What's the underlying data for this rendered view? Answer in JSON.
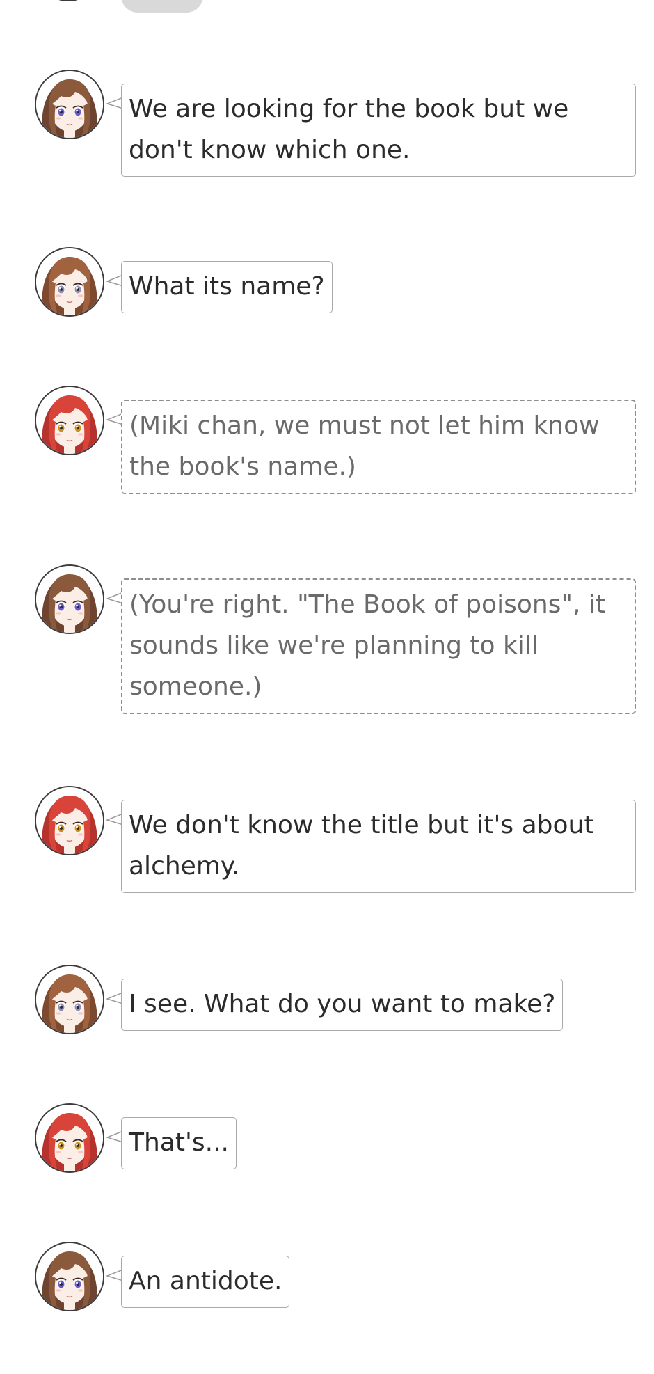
{
  "characters": {
    "brown": {
      "hair": "#8b5a3c",
      "hair_dark": "#6e4430",
      "eye": "#6a5acd",
      "skin": "#fbeee6"
    },
    "auburn": {
      "hair": "#a0623f",
      "hair_dark": "#7d4a2f",
      "eye": "#8f8fb8",
      "skin": "#fbeee6"
    },
    "red": {
      "hair": "#d9443a",
      "hair_dark": "#b5332c",
      "eye": "#c9901c",
      "skin": "#fbeee6"
    }
  },
  "messages": [
    {
      "speaker": "brown",
      "kind": "speech",
      "text": "We are looking for the book but we don't know which one."
    },
    {
      "speaker": "auburn",
      "kind": "speech",
      "text": "What its name?"
    },
    {
      "speaker": "red",
      "kind": "thought",
      "text": "(Miki chan, we must not let him know the book's name.)"
    },
    {
      "speaker": "brown",
      "kind": "thought",
      "text": "(You're right. \"The Book of poisons\", it sounds like we're planning to kill someone.)"
    },
    {
      "speaker": "red",
      "kind": "speech",
      "text": "We don't know the title but it's about alchemy."
    },
    {
      "speaker": "auburn",
      "kind": "speech",
      "text": "I see. What do you want to make?"
    },
    {
      "speaker": "red",
      "kind": "speech",
      "text": "That's..."
    },
    {
      "speaker": "brown",
      "kind": "speech",
      "text": "An antidote."
    }
  ]
}
